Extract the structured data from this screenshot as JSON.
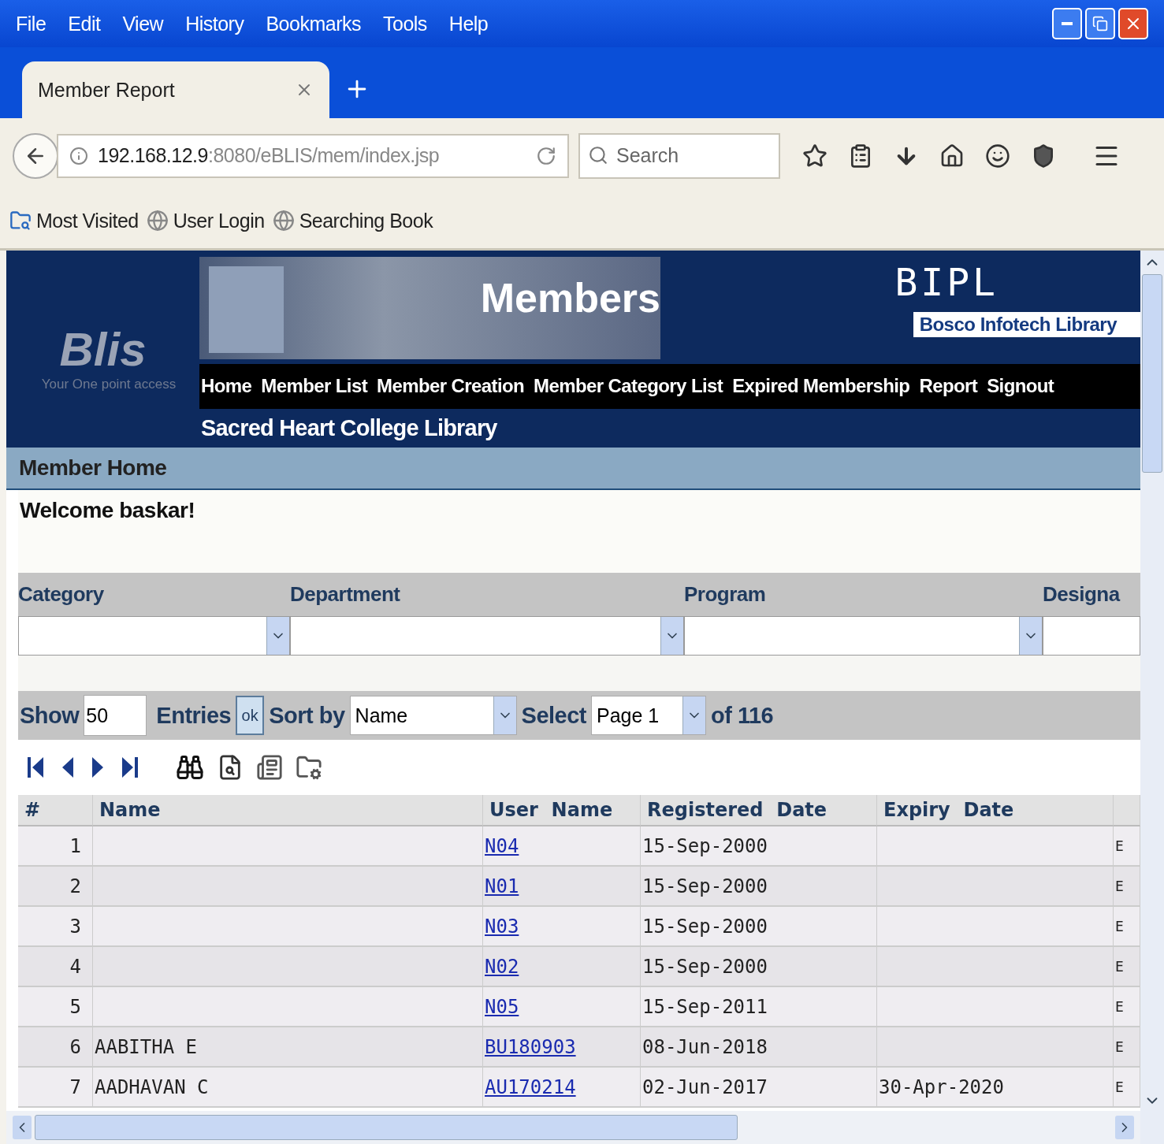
{
  "menu": [
    "File",
    "Edit",
    "View",
    "History",
    "Bookmarks",
    "Tools",
    "Help"
  ],
  "tab": {
    "title": "Member Report",
    "selected": true
  },
  "address": {
    "host": "192.168.12.9",
    "rest": ":8080/eBLIS/mem/index.jsp"
  },
  "search": {
    "placeholder": "Search"
  },
  "bookmarks": [
    {
      "kind": "folder",
      "label": "Most Visited"
    },
    {
      "kind": "globe",
      "label": "User Login"
    },
    {
      "kind": "globe",
      "label": "Searching Book"
    }
  ],
  "banner": {
    "logo": "Blis",
    "tagline": "Your One point access",
    "title": "Members",
    "brand": "BIPL",
    "brand_name": "Bosco Infotech Library",
    "library": "Sacred Heart College Library"
  },
  "nav": [
    "Home",
    "Member List",
    "Member Creation",
    "Member Category List",
    "Expired Membership",
    "Report",
    "Signout"
  ],
  "section_title": "Member Home",
  "welcome": "Welcome baskar!",
  "filters": [
    {
      "label": "Category"
    },
    {
      "label": "Department"
    },
    {
      "label": "Program"
    },
    {
      "label": "Designa"
    }
  ],
  "controls": {
    "show_label": "Show",
    "entries": "50",
    "entries_label": "Entries",
    "ok": "ok",
    "sort_label": "Sort by",
    "sort": "Name",
    "select_label": "Select",
    "page": "Page 1",
    "of": "of 116"
  },
  "table": {
    "columns": [
      "#",
      "Name",
      "User  Name",
      "Registered  Date",
      "Expiry  Date"
    ],
    "rows": [
      {
        "num": "1",
        "name": "",
        "user": "N04",
        "registered": "15-Sep-2000",
        "expiry": "",
        "column_6": "E"
      },
      {
        "num": "2",
        "name": "",
        "user": "N01",
        "registered": "15-Sep-2000",
        "expiry": "",
        "column_6": "E"
      },
      {
        "num": "3",
        "name": "",
        "user": "N03",
        "registered": "15-Sep-2000",
        "expiry": "",
        "column_6": "E"
      },
      {
        "num": "4",
        "name": "",
        "user": "N02",
        "registered": "15-Sep-2000",
        "expiry": "",
        "column_6": "E"
      },
      {
        "num": "5",
        "name": "",
        "user": "N05",
        "registered": "15-Sep-2011",
        "expiry": "",
        "column_6": "E"
      },
      {
        "num": "6",
        "name": "AABITHA E",
        "user": "BU180903",
        "registered": "08-Jun-2018",
        "expiry": "",
        "column_6": "E"
      },
      {
        "num": "7",
        "name": "AADHAVAN C",
        "user": "AU170214",
        "registered": "02-Jun-2017",
        "expiry": "30-Apr-2020",
        "column_6": "E"
      }
    ]
  }
}
